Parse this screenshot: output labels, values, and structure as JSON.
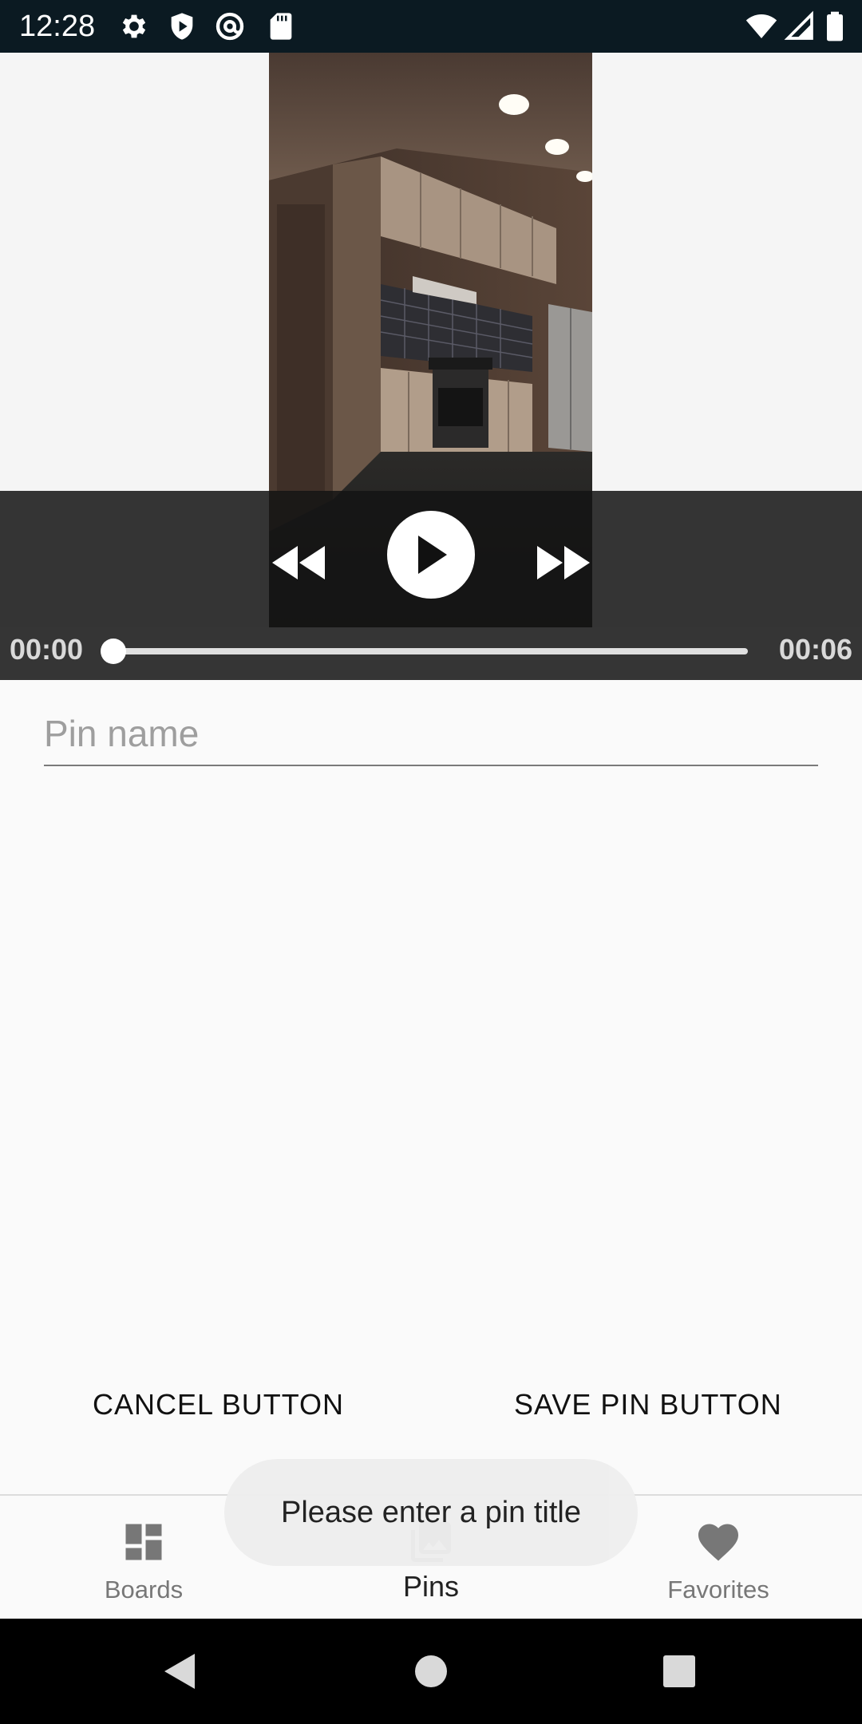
{
  "status_bar": {
    "time": "12:28",
    "left_icons": [
      "gear-icon",
      "shield-icon",
      "at-sign-icon",
      "sd-card-icon"
    ],
    "right_icons": [
      "wifi-icon",
      "signal-icon",
      "battery-icon"
    ]
  },
  "video_player": {
    "thumbnail": "kitchen-interior",
    "current_time": "00:00",
    "total_time": "00:06",
    "progress": 0,
    "controls": [
      "rewind-icon",
      "play-icon",
      "fast-forward-icon"
    ]
  },
  "form": {
    "pin_name_placeholder": "Pin name",
    "pin_name_value": ""
  },
  "actions": {
    "cancel_label": "CANCEL BUTTON",
    "save_label": "SAVE PIN BUTTON"
  },
  "bottom_nav": {
    "items": [
      {
        "label": "Boards",
        "icon": "dashboard-icon",
        "active": false
      },
      {
        "label": "Pins",
        "icon": "image-library-icon",
        "active": true
      },
      {
        "label": "Favorites",
        "icon": "heart-icon",
        "active": false
      }
    ]
  },
  "toast": {
    "message": "Please enter a pin title"
  },
  "system_nav": [
    "back-icon",
    "home-icon",
    "recents-icon"
  ]
}
